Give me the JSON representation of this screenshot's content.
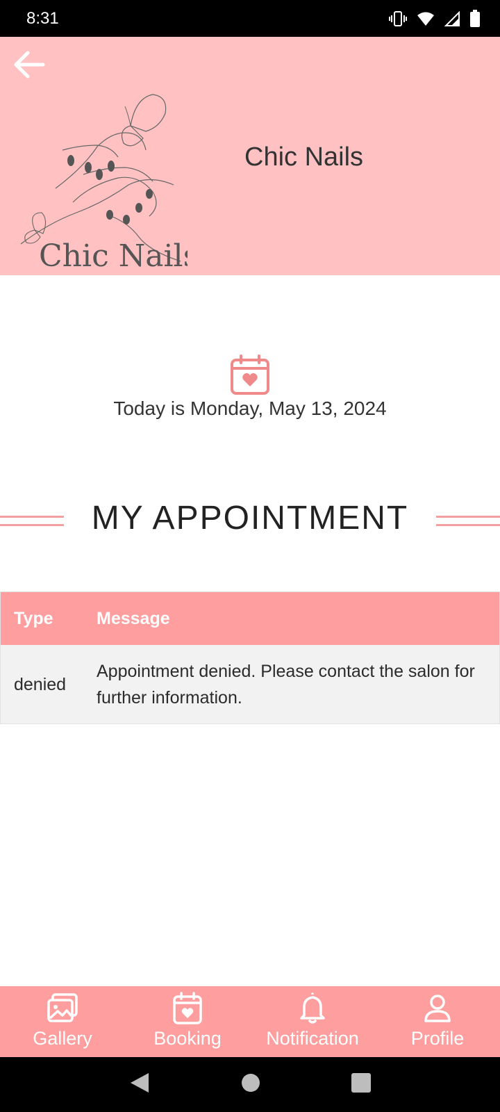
{
  "status_bar": {
    "time": "8:31",
    "icons": [
      "vibrate-icon",
      "wifi-icon",
      "signal-icon",
      "battery-icon"
    ]
  },
  "header": {
    "back_icon": "arrow-left-icon",
    "logo_text": "Chic Nails",
    "salon_name": "Chic Nails",
    "background_color": "#ffc1c1"
  },
  "date_section": {
    "icon": "calendar-heart-icon",
    "text": "Today is Monday, May 13, 2024"
  },
  "section": {
    "title": "MY APPOINTMENT"
  },
  "table": {
    "headers": {
      "type": "Type",
      "message": "Message"
    },
    "rows": [
      {
        "type": "denied",
        "message": "Appointment denied. Please contact the salon for further information."
      }
    ]
  },
  "bottom_nav": {
    "items": [
      {
        "label": "Gallery",
        "icon": "gallery-icon"
      },
      {
        "label": "Booking",
        "icon": "calendar-heart-icon"
      },
      {
        "label": "Notification",
        "icon": "bell-icon"
      },
      {
        "label": "Profile",
        "icon": "user-icon"
      }
    ]
  },
  "colors": {
    "accent": "#ff9e9e",
    "header_bg": "#ffc1c1",
    "row_bg": "#f2f2f2"
  }
}
